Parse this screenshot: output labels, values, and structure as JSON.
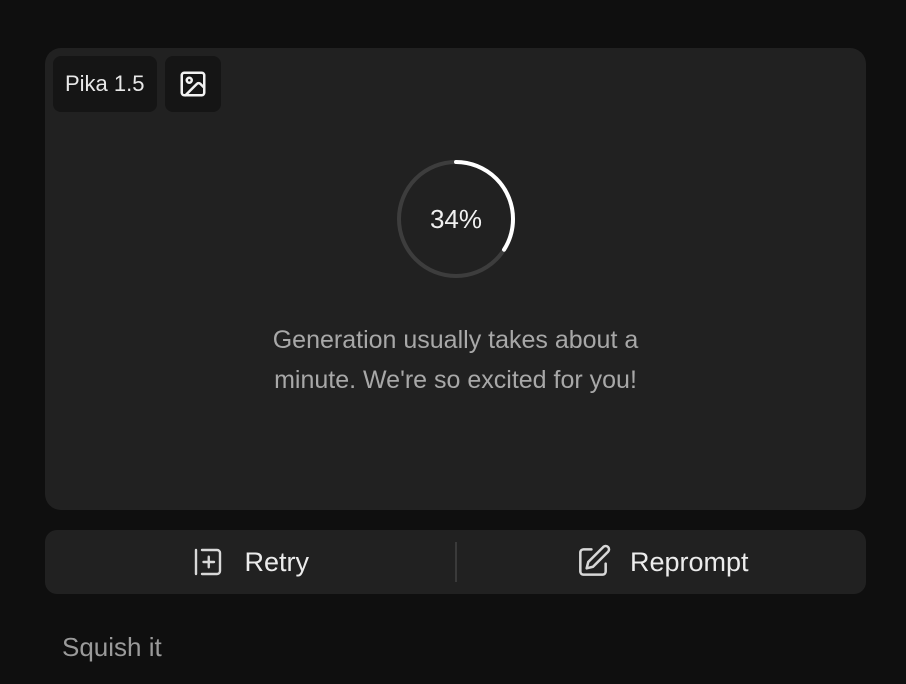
{
  "card": {
    "model_badge": "Pika 1.5",
    "image_icon": "image-icon",
    "progress": {
      "value_fraction": 0.34,
      "label": "34%"
    },
    "message_line1": "Generation usually takes about a",
    "message_line2": "minute. We're so excited for you!"
  },
  "actions": {
    "retry_label": "Retry",
    "retry_icon": "retry-icon",
    "reprompt_label": "Reprompt",
    "reprompt_icon": "edit-icon"
  },
  "prompt": "Squish it",
  "colors": {
    "background": "#0f0f0f",
    "card": "#212121",
    "badge": "#151515",
    "progress_track": "#3d3d3d",
    "progress_fill": "#ffffff"
  }
}
